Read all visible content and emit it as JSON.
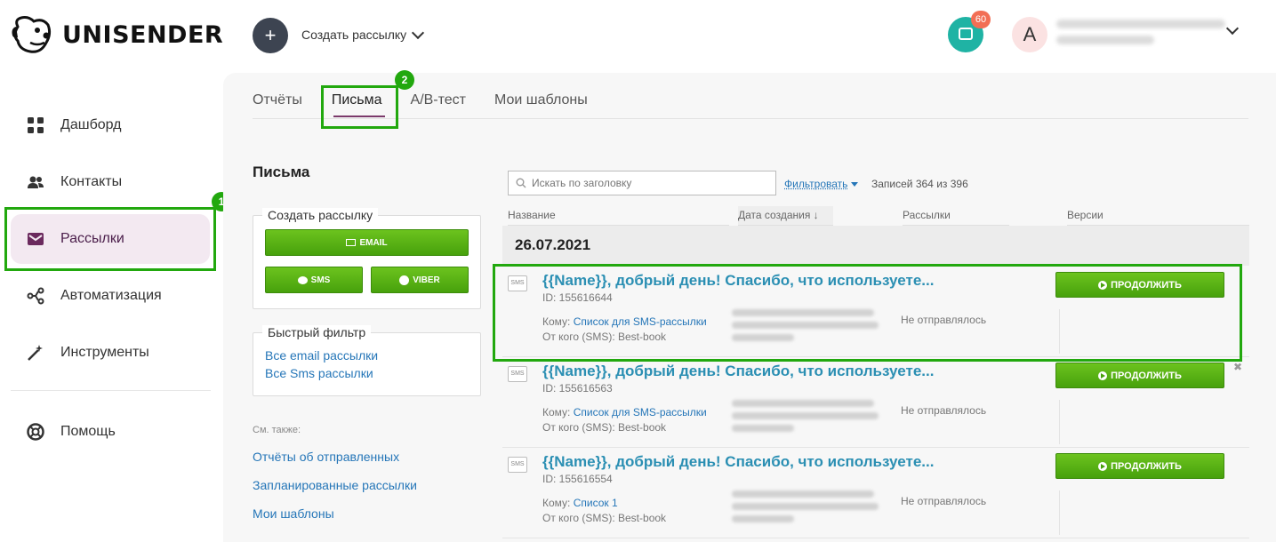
{
  "brand": "UNISENDER",
  "header": {
    "create_label": "Создать рассылку",
    "chat_badge": "60",
    "avatar_letter": "A"
  },
  "sidebar": {
    "items": [
      {
        "label": "Дашборд",
        "icon": "dashboard-icon"
      },
      {
        "label": "Контакты",
        "icon": "contacts-icon"
      },
      {
        "label": "Рассылки",
        "icon": "mail-icon"
      },
      {
        "label": "Автоматизация",
        "icon": "automation-icon"
      },
      {
        "label": "Инструменты",
        "icon": "tools-icon"
      },
      {
        "label": "Помощь",
        "icon": "help-icon"
      }
    ],
    "highlight_number": "1"
  },
  "tabs": [
    {
      "label": "Отчёты"
    },
    {
      "label": "Письма"
    },
    {
      "label": "A/B-тест"
    },
    {
      "label": "Мои шаблоны"
    }
  ],
  "tabs_highlight_number": "2",
  "left_panel": {
    "title": "Письма",
    "create_legend": "Создать рассылку",
    "email_btn": "EMAIL",
    "sms_btn": "SMS",
    "viber_btn": "VIBER",
    "filter_legend": "Быстрый фильтр",
    "filter_links": [
      "Все email рассылки",
      "Все Sms рассылки"
    ],
    "see_also": "См. также:",
    "see_also_links": [
      "Отчёты об отправленных",
      "Запланированные рассылки",
      "Мои шаблоны"
    ]
  },
  "list": {
    "search_placeholder": "Искать по заголовку",
    "filter_label": "Фильтровать",
    "records": "Записей 364 из 396",
    "columns": [
      "Название",
      "Дата создания ↓",
      "Рассылки",
      "Версии"
    ],
    "date_group": "26.07.2021",
    "continue_label": "ПРОДОЛЖИТЬ",
    "rows": [
      {
        "title": "{{Name}}, добрый день! Спасибо, что используете...",
        "id": "ID: 155616644",
        "to_prefix": "Кому:",
        "to_link": "Список для SMS-рассылки",
        "from": "От кого (SMS): Best-book",
        "status": "Не отправлялось"
      },
      {
        "title": "{{Name}}, добрый день! Спасибо, что используете...",
        "id": "ID: 155616563",
        "to_prefix": "Кому:",
        "to_link": "Список для SMS-рассылки",
        "from": "От кого (SMS): Best-book",
        "status": "Не отправлялось"
      },
      {
        "title": "{{Name}}, добрый день! Спасибо, что используете...",
        "id": "ID: 155616554",
        "to_prefix": "Кому:",
        "to_link": "Список 1",
        "from": "От кого (SMS): Best-book",
        "status": "Не отправлялось"
      }
    ]
  },
  "colors": {
    "accent_green": "#22a80e",
    "active_nav": "#f3e9f1",
    "link": "#2576b8",
    "title_link": "#2b8fb3",
    "chat": "#1fb3a4",
    "badge": "#f26f55"
  }
}
